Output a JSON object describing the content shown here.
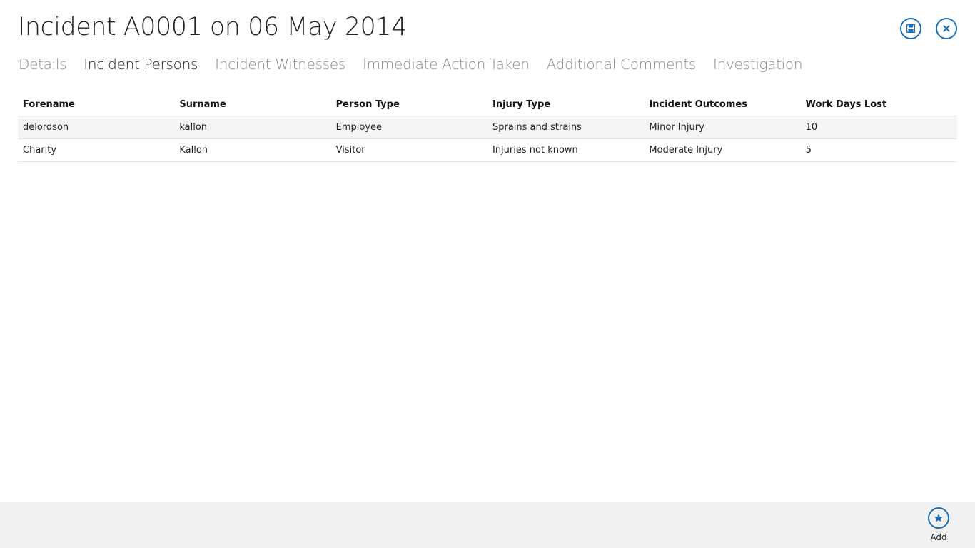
{
  "header": {
    "title": "Incident A0001 on 06 May 2014",
    "save_icon": "save-icon",
    "close_icon": "close-icon"
  },
  "tabs": [
    {
      "label": "Details",
      "active": false
    },
    {
      "label": "Incident Persons",
      "active": true
    },
    {
      "label": "Incident Witnesses",
      "active": false
    },
    {
      "label": "Immediate Action Taken",
      "active": false
    },
    {
      "label": "Additional Comments",
      "active": false
    },
    {
      "label": "Investigation",
      "active": false
    }
  ],
  "table": {
    "columns": [
      "Forename",
      "Surname",
      "Person Type",
      "Injury Type",
      "Incident Outcomes",
      "Work Days Lost"
    ],
    "rows": [
      [
        "delordson",
        "kallon",
        "Employee",
        "Sprains and strains",
        "Minor Injury",
        "10"
      ],
      [
        "Charity",
        "Kallon",
        "Visitor",
        "Injuries not known",
        "Moderate Injury",
        "5"
      ]
    ]
  },
  "appbar": {
    "add_label": "Add",
    "add_icon": "star-icon"
  },
  "colors": {
    "accent": "#1a6fb4",
    "appbar_bg": "#f1f1f1",
    "row_alt_bg": "#f4f4f4"
  }
}
